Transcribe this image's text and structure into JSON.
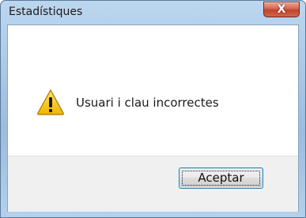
{
  "window": {
    "title": "Estadístiques",
    "close_glyph": "X",
    "title_icon": "close-icon"
  },
  "dialog": {
    "icon": "warning-icon",
    "message": "Usuari i clau incorrectes",
    "ok_label": "Aceptar"
  },
  "colors": {
    "title_gradient": "#a9c7e6",
    "close_red": "#c0452c",
    "footer_bg": "#f0f0f0",
    "button_border": "#3c7fb1",
    "warning_yellow": "#f5c400"
  }
}
